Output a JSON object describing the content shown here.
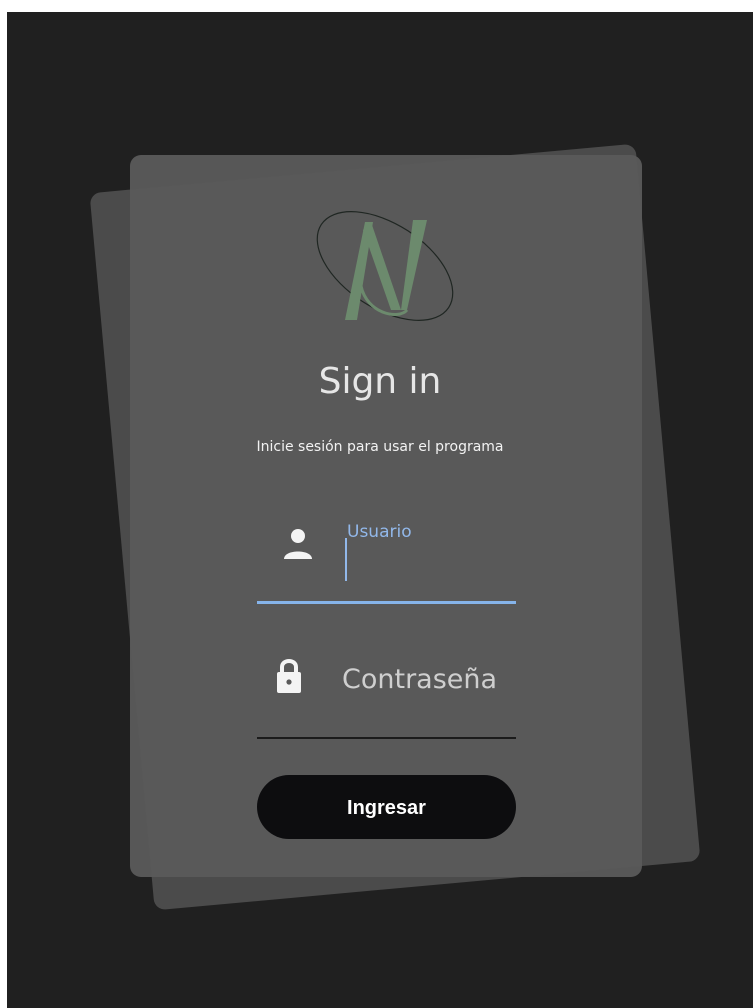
{
  "login": {
    "title": "Sign in",
    "subtitle": "Inicie sesión para usar el programa",
    "username": {
      "label": "Usuario",
      "value": ""
    },
    "password": {
      "placeholder": "Contraseña",
      "value": ""
    },
    "submit_label": "Ingresar"
  },
  "icons": {
    "username": "person-icon",
    "password": "lock-icon",
    "logo": "av-monogram-logo"
  },
  "colors": {
    "background": "#202020",
    "card": "#5a5a5a",
    "logo": "#6c8a6d",
    "focus": "#86b4ea",
    "button": "#0d0d0f"
  }
}
